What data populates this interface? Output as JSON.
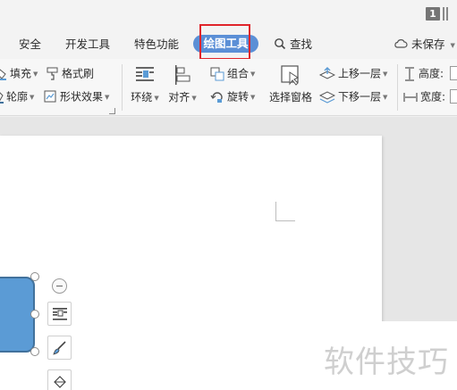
{
  "titlebar": {
    "page_badge": "1"
  },
  "tabs": {
    "security": "安全",
    "developer_tools": "开发工具",
    "special_features": "特色功能",
    "drawing_tools": "绘图工具",
    "find": "查找",
    "unsaved": "未保存"
  },
  "ribbon": {
    "fill": "填充",
    "format_painter": "格式刷",
    "outline": "轮廓",
    "shape_effects": "形状效果",
    "wrap": "环绕",
    "align": "对齐",
    "group": "组合",
    "rotate": "旋转",
    "selection_pane": "选择窗格",
    "bring_forward": "上移一层",
    "send_backward": "下移一层",
    "height": "高度:",
    "width": "宽度:"
  },
  "watermark": "软件技巧",
  "colors": {
    "accent": "#5b8fd6",
    "shape_fill": "#5b9bd5",
    "highlight": "#e0242b"
  }
}
